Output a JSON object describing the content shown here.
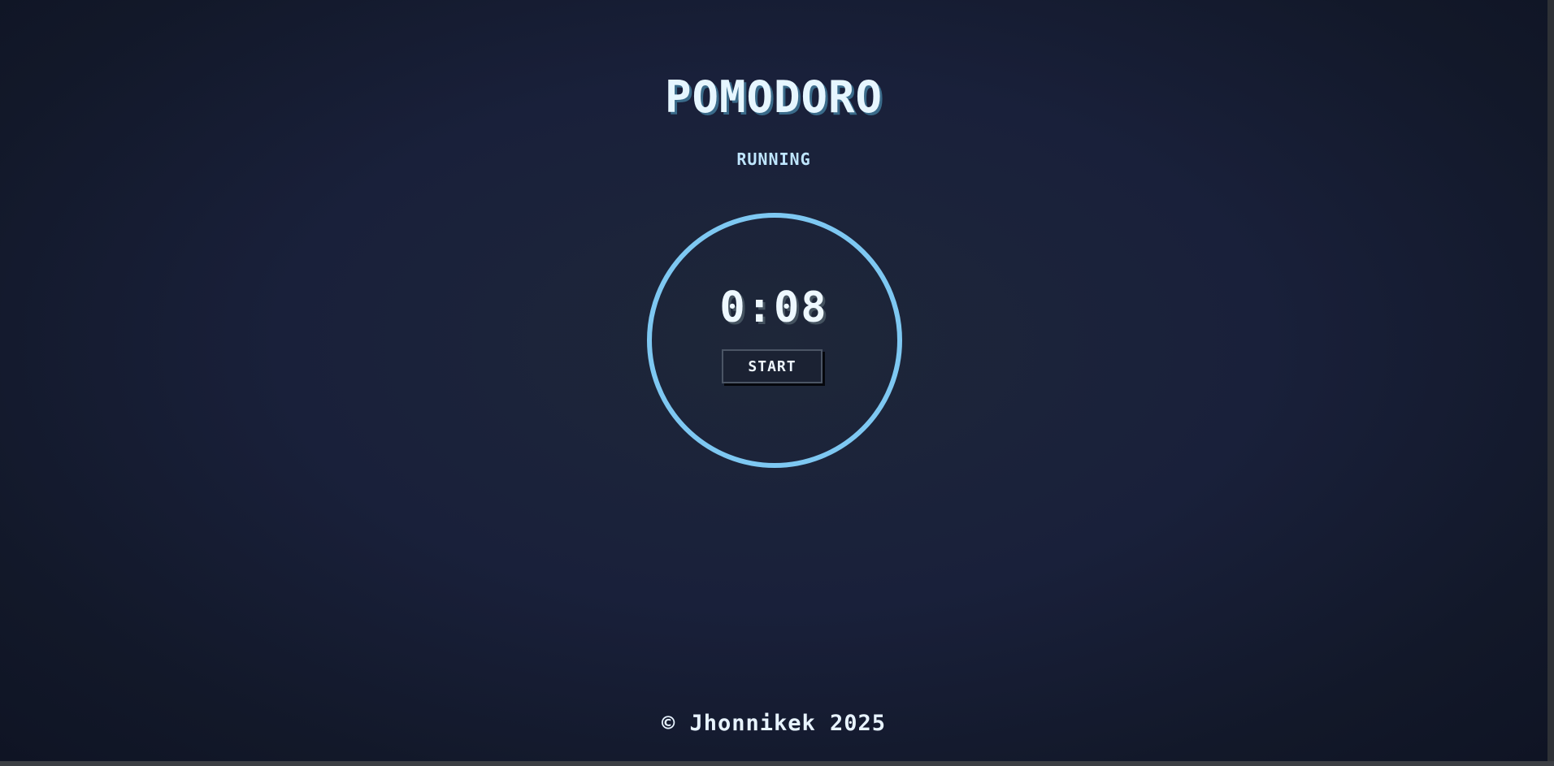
{
  "app": {
    "title": "POMODORO",
    "status": "RUNNING"
  },
  "timer": {
    "display": "0:08",
    "start_label": "START"
  },
  "footer": {
    "text": "© Jhonnikek 2025"
  },
  "colors": {
    "background": "#19203a",
    "ring": "#7ec8f2",
    "title": "#e6f6ff",
    "status": "#bfe6ff",
    "button_bg": "#1b2233"
  }
}
